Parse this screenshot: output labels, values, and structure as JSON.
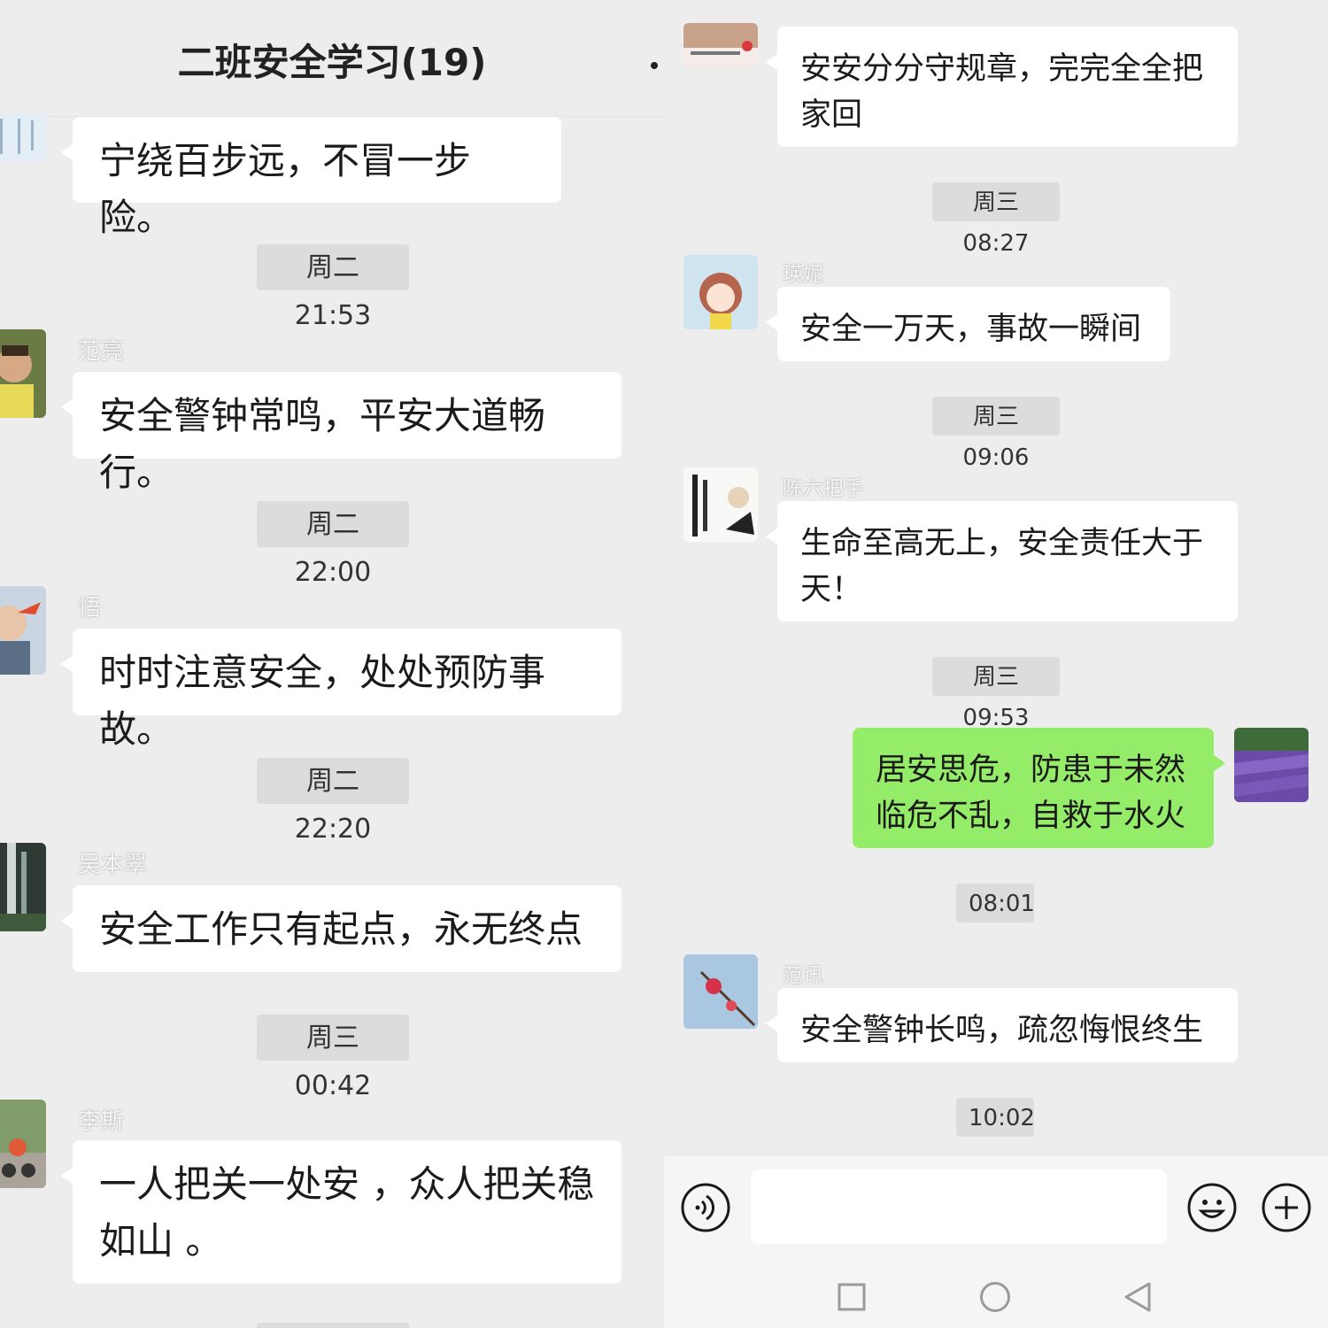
{
  "header": {
    "title": "二班安全学习(19)"
  },
  "left_messages": [
    {
      "text": "宁绕百步远，不冒一步险。"
    },
    {
      "time": "周二 21:53",
      "sender": "范亮",
      "text": "安全警钟常鸣，平安大道畅行。"
    },
    {
      "time": "周二 22:00",
      "sender": "悟",
      "text": "时时注意安全，处处预防事故。"
    },
    {
      "time": "周二 22:20",
      "sender": "吴本翠",
      "text": "安全工作只有起点，永无终点"
    },
    {
      "time": "周三 00:42",
      "sender": "李斯",
      "line1": "一人把关一处安 ，众人把关稳",
      "line2": "如山 。"
    }
  ],
  "right_messages": [
    {
      "line1": "安安分分守规章，完完全全把",
      "line2": "家回"
    },
    {
      "time": "周三 08:27",
      "sender": "瑛妮",
      "text": "安全一万天，事故一瞬间"
    },
    {
      "time": "周三 09:06",
      "sender": "陈六把手",
      "line1": "生命至高无上，安全责任大于",
      "line2": "天！"
    },
    {
      "time": "周三 09:53",
      "line1": "居安思危，防患于未然",
      "line2": "临危不乱，自救于水火"
    },
    {
      "time": "08:01",
      "sender": "范讯",
      "text": "安全警钟长鸣，疏忽悔恨终生"
    },
    {
      "time": "10:02"
    }
  ],
  "colors": {
    "own_bubble": "#95ec69",
    "bubble": "#ffffff",
    "background": "#ededed"
  },
  "icons": [
    "voice-icon",
    "emoji-icon",
    "plus-icon",
    "nav-square-icon",
    "nav-circle-icon",
    "nav-back-icon"
  ]
}
